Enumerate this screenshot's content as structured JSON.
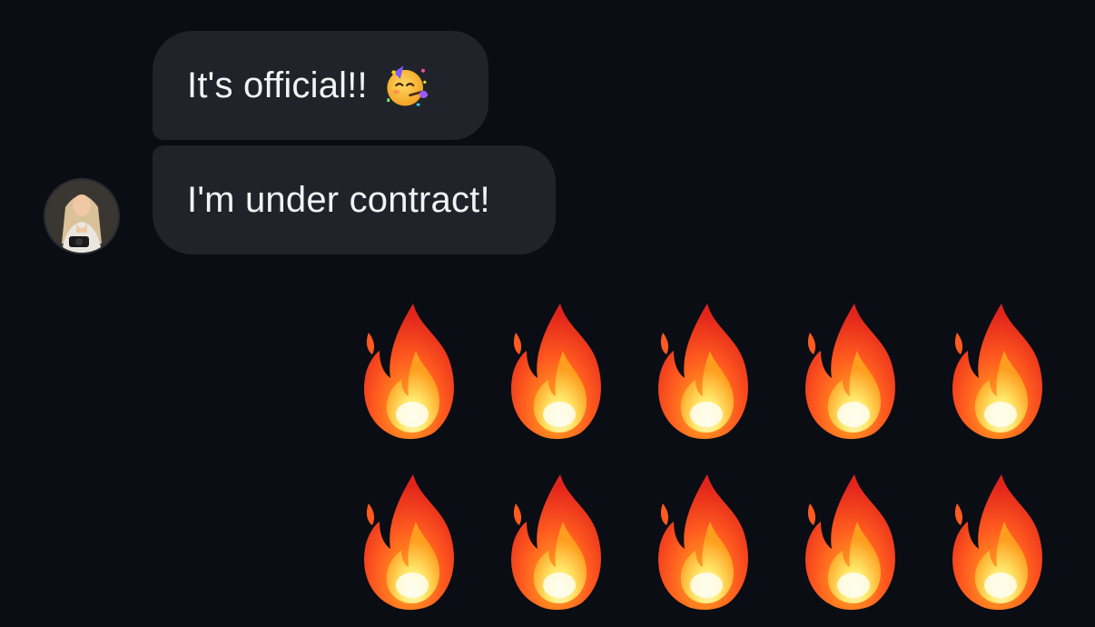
{
  "conversation": {
    "messages": [
      {
        "text": "It's official!!",
        "emoji": "partying-face"
      },
      {
        "text": "I'm under contract!"
      }
    ],
    "sender_avatar": {
      "icon": "profile-photo"
    },
    "reply": {
      "emoji": "fire",
      "count": 10,
      "rows": 2,
      "per_row": 5
    }
  },
  "colors": {
    "background": "#0b0d14",
    "bubble": "#202329",
    "text": "#f2f3f5"
  }
}
